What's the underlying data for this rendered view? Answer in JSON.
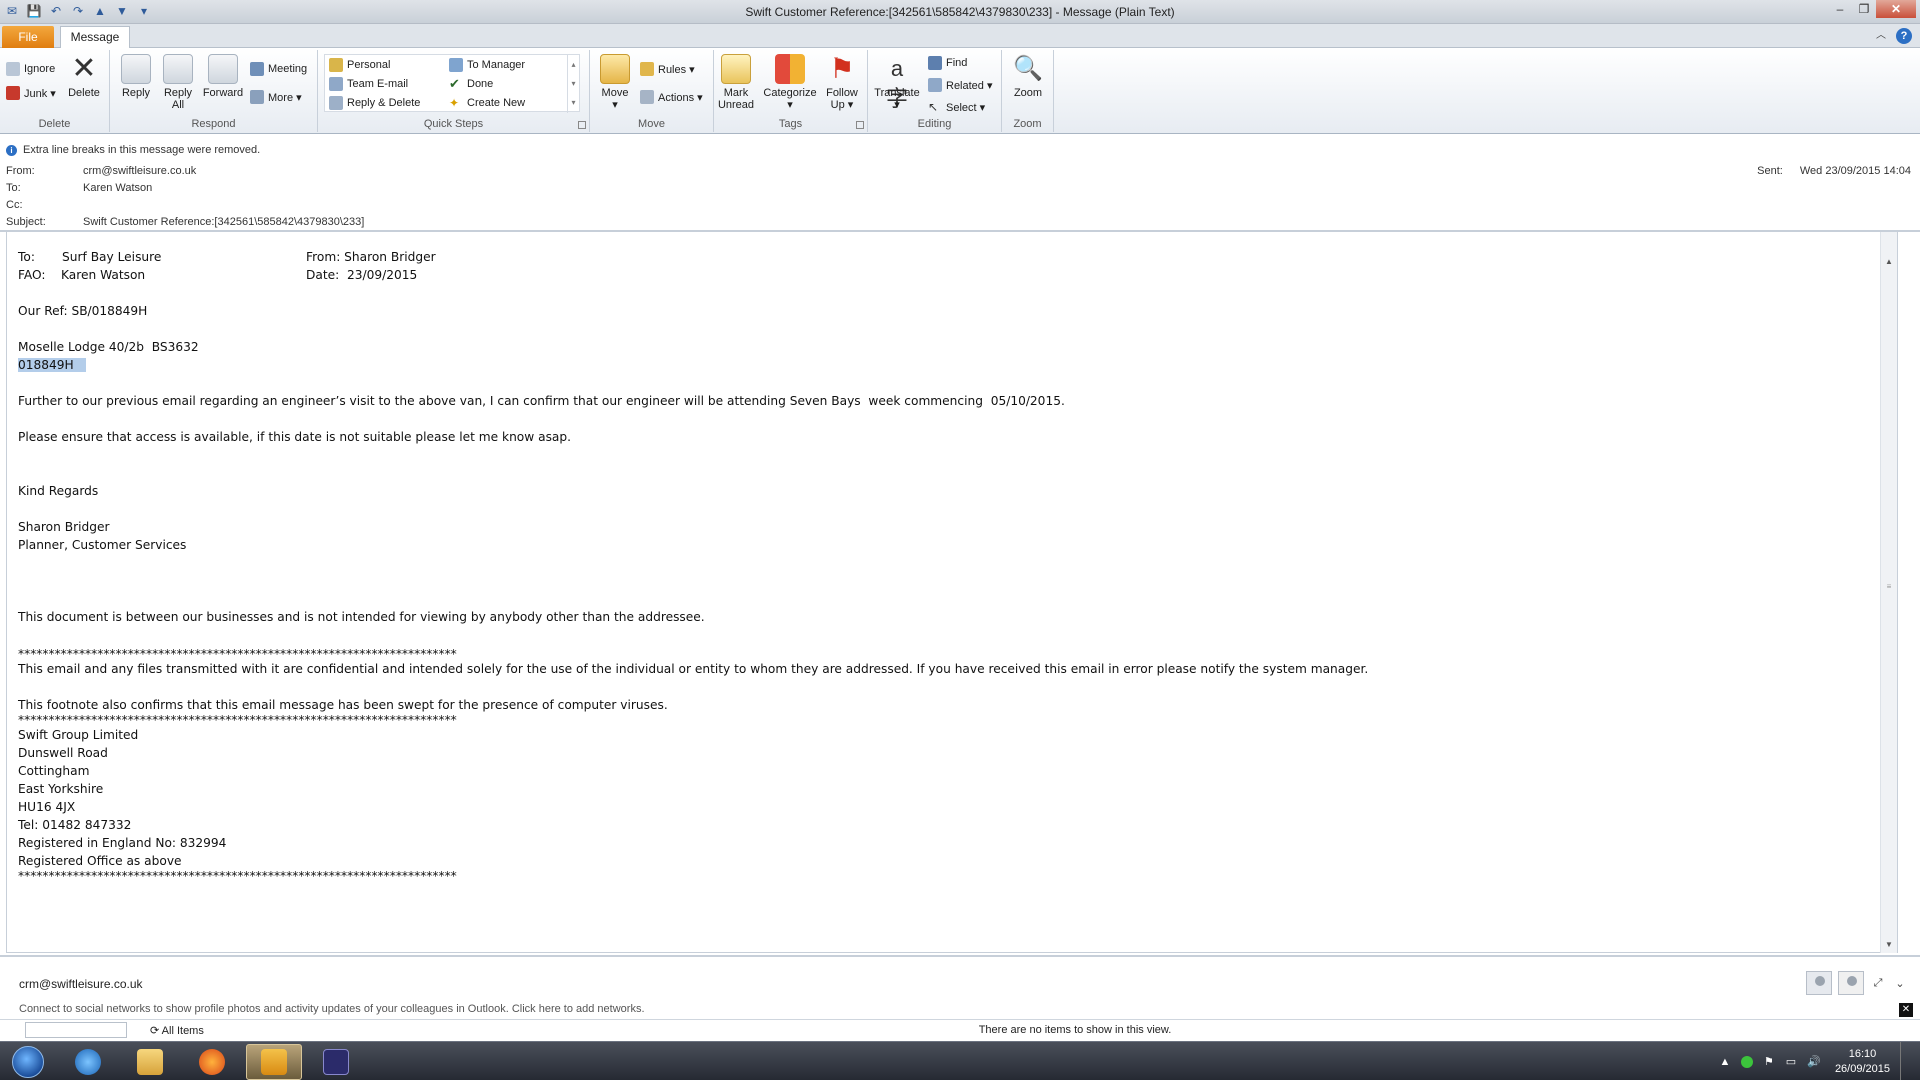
{
  "window": {
    "title": "Swift Customer Reference:[342561\\585842\\4379830\\233]  -  Message (Plain Text)"
  },
  "tabs": {
    "file": "File",
    "message": "Message"
  },
  "ribbon": {
    "delete_group": {
      "ignore": "Ignore",
      "junk": "Junk ▾",
      "delete": "Delete",
      "label": "Delete"
    },
    "respond_group": {
      "reply": "Reply",
      "reply_all_1": "Reply",
      "reply_all_2": "All",
      "forward": "Forward",
      "meeting": "Meeting",
      "more": "More ▾",
      "label": "Respond"
    },
    "quick_steps": {
      "personal": "Personal",
      "team_email": "Team E-mail",
      "reply_delete": "Reply & Delete",
      "to_manager": "To Manager",
      "done": "Done",
      "create_new": "Create New",
      "label": "Quick Steps"
    },
    "move_group": {
      "move_1": "Move",
      "move_2": "▾",
      "rules": "Rules ▾",
      "actions": "Actions ▾",
      "label": "Move"
    },
    "tags_group": {
      "mark_1": "Mark",
      "mark_2": "Unread",
      "categorize_1": "Categorize",
      "categorize_2": "▾",
      "follow_1": "Follow",
      "follow_2": "Up ▾",
      "label": "Tags"
    },
    "editing_group": {
      "translate_1": "Translate",
      "translate_2": "▾",
      "find": "Find",
      "related": "Related ▾",
      "select": "Select ▾",
      "label": "Editing"
    },
    "zoom_group": {
      "zoom": "Zoom",
      "label": "Zoom"
    }
  },
  "header": {
    "info": "Extra line breaks in this message were removed.",
    "from_label": "From:",
    "from": "crm@swiftleisure.co.uk",
    "to_label": "To:",
    "to": "Karen Watson",
    "cc_label": "Cc:",
    "cc": "",
    "subject_label": "Subject:",
    "subject": "Swift Customer Reference:[342561\\585842\\4379830\\233]",
    "sent_label": "Sent:",
    "sent": "Wed 23/09/2015 14:04"
  },
  "body": {
    "to_line": "To:       Surf Bay Leisure",
    "from_line": "From: Sharon Bridger",
    "fao_line": "FAO:    Karen Watson",
    "date_line": "Date:  23/09/2015",
    "ref": "Our Ref: SB/018849H",
    "vehicle": "Moselle Lodge 40/2b  BS3632",
    "vehicle_ref": "018849H",
    "para1": "Further to our previous email regarding an engineer’s visit to the above van, I can confirm that our engineer will be attending Seven Bays  week commencing  05/10/2015.",
    "para2": "Please ensure that access is available, if this date is not suitable please let me know asap.",
    "regards": "Kind Regards",
    "sig_name": "Sharon Bridger",
    "sig_title": "Planner, Customer Services",
    "notice": "This document is between our businesses and is not intended for viewing by anybody other than the addressee.",
    "stars": "************************************************************************",
    "conf": "This email and any files transmitted with it are confidential and intended solely for the use of the individual or entity to whom they are addressed. If you have received this email in error please notify the system manager.",
    "virus": "This footnote also confirms that this email message has been swept for the presence of computer viruses.",
    "addr1": "Swift Group Limited",
    "addr2": "Dunswell Road",
    "addr3": "Cottingham",
    "addr4": "East Yorkshire",
    "addr5": "HU16 4JX",
    "tel": "Tel: 01482 847332",
    "reg": "Registered in England No: 832994",
    "office": "Registered Office as above"
  },
  "people_pane": {
    "name": "crm@swiftleisure.co.uk",
    "message": "Connect to social networks to show profile photos and activity updates of your colleagues in Outlook. Click here to add networks."
  },
  "status": {
    "all_items": "All Items",
    "empty": "There are no items to show in this view."
  },
  "taskbar": {
    "time": "16:10",
    "date": "26/09/2015"
  }
}
